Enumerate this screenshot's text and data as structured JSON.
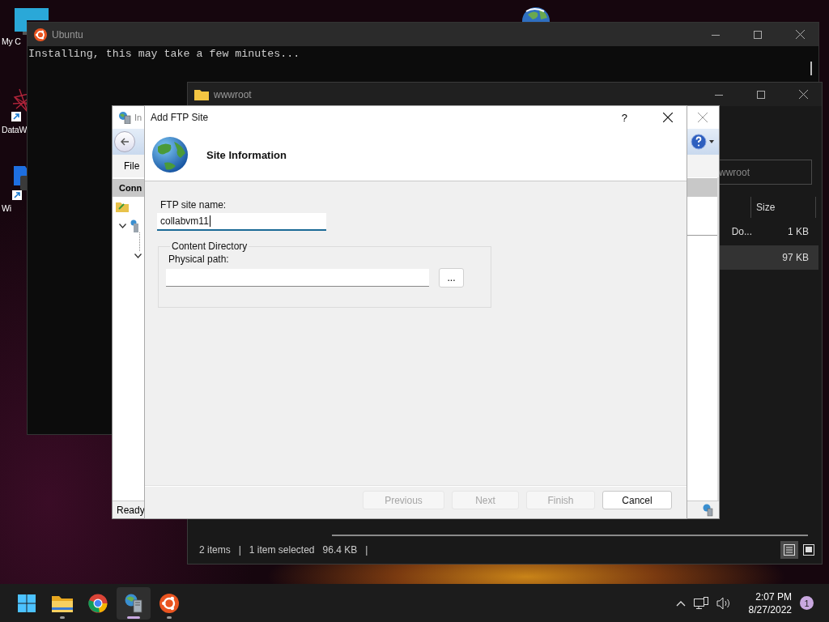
{
  "desktop_icons": [
    {
      "kind": "monitor",
      "label": "My C"
    },
    {
      "kind": "mesh",
      "label": "DataW"
    },
    {
      "kind": "shield",
      "label": "Wi"
    }
  ],
  "terminal": {
    "title": "Ubuntu",
    "lines": [
      "Installing, this may take a few minutes..."
    ]
  },
  "explorer": {
    "title": "wwwroot",
    "search": {
      "placeholder": "wwroot"
    },
    "columns": [
      {
        "label": "Size"
      }
    ],
    "rows": [
      {
        "name": "Do...",
        "size": "1 KB",
        "selected": false
      },
      {
        "size": "97 KB",
        "selected": true
      }
    ],
    "status": [
      "2 items",
      "|",
      "1 item selected",
      "96.4 KB",
      "|"
    ],
    "views": [
      {
        "kind": "details",
        "selected": true
      },
      {
        "kind": "tiles",
        "selected": false
      }
    ]
  },
  "iis": {
    "title": "In",
    "menu": [
      "File"
    ],
    "panel_title": "Conn",
    "status": "Ready"
  },
  "dialog": {
    "title": "Add FTP Site",
    "help": "?",
    "heading": "Site Information",
    "site_name": {
      "label": "FTP site name:",
      "value": "collabvm11",
      "focused": true
    },
    "group": {
      "title": "Content Directory",
      "path": {
        "label": "Physical path:",
        "focused": false
      },
      "browse": "..."
    },
    "buttons": [
      {
        "label": "Previous",
        "disabled": true
      },
      {
        "label": "Next",
        "disabled": true
      },
      {
        "label": "Finish",
        "disabled": true
      },
      {
        "label": "Cancel",
        "disabled": false
      }
    ]
  },
  "taskbar": {
    "apps": [
      {
        "kind": "start",
        "running": false,
        "selected": false
      },
      {
        "kind": "folder",
        "running": true,
        "selected": false
      },
      {
        "kind": "browser",
        "running": false,
        "selected": false
      },
      {
        "kind": "server",
        "running": true,
        "selected": true
      },
      {
        "kind": "ubuntu",
        "running": true,
        "selected": false
      }
    ],
    "time": "2:07 PM",
    "date": "8/27/2022",
    "notifications": "1"
  }
}
